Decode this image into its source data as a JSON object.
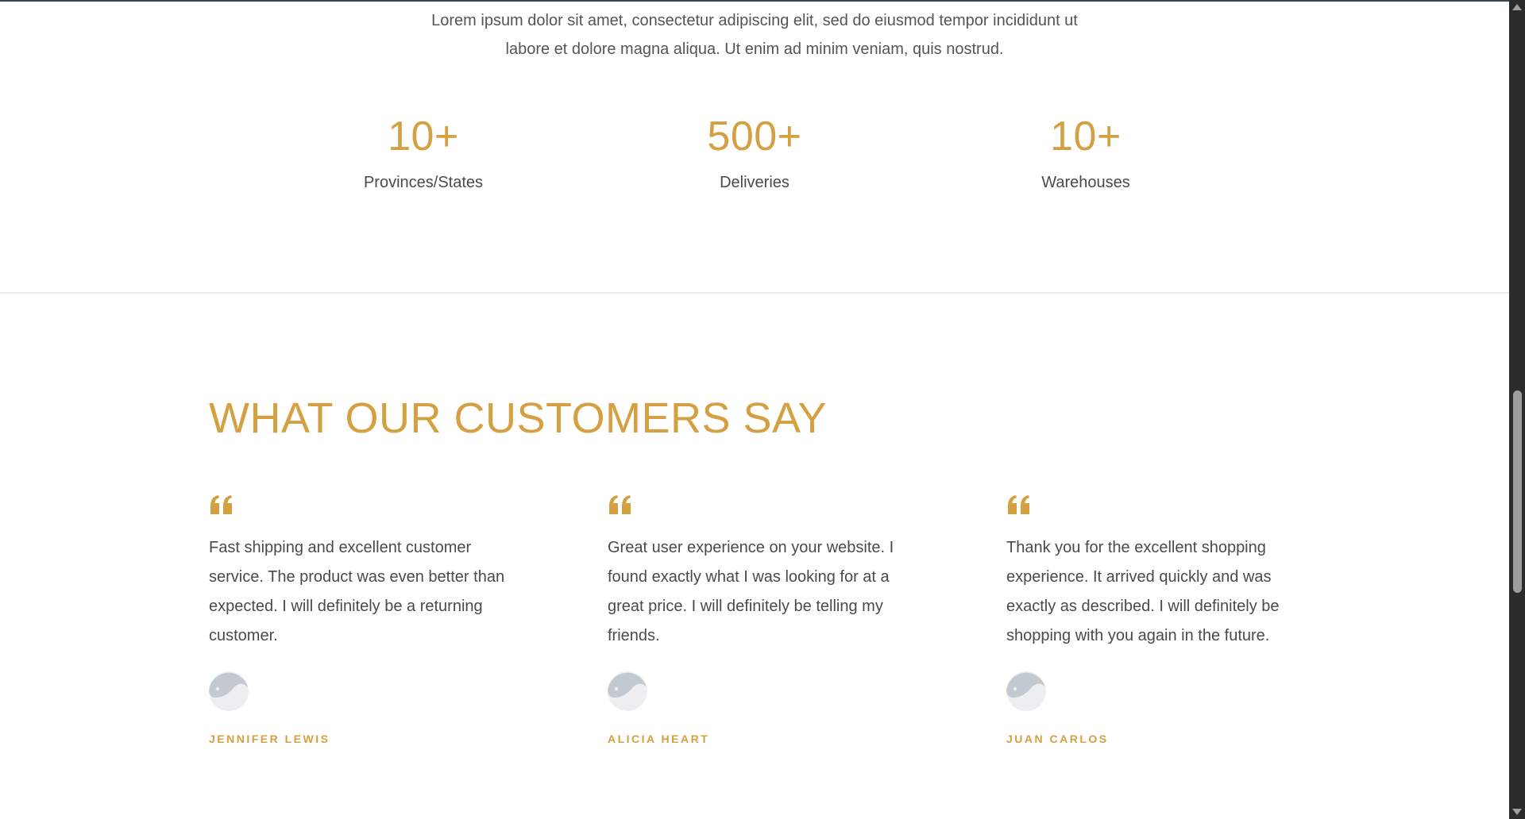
{
  "intro": {
    "line1": "Lorem ipsum dolor sit amet, consectetur adipiscing elit, sed do eiusmod tempor incididunt ut",
    "line2": "labore et dolore magna aliqua. Ut enim ad minim veniam, quis nostrud."
  },
  "stats": [
    {
      "value": "10+",
      "label": "Provinces/States"
    },
    {
      "value": "500+",
      "label": "Deliveries"
    },
    {
      "value": "10+",
      "label": "Warehouses"
    }
  ],
  "testimonials_section": {
    "title": "WHAT OUR CUSTOMERS SAY",
    "items": [
      {
        "quote": "Fast shipping and excellent customer service. The product was even better than expected. I will definitely be a returning customer.",
        "author": "JENNIFER LEWIS",
        "quote_icon": "quote-icon",
        "avatar_icon": "avatar-placeholder-icon"
      },
      {
        "quote": "Great user experience on your website. I found exactly what I was looking for at a great price. I will definitely be telling my friends.",
        "author": "ALICIA HEART",
        "quote_icon": "quote-icon",
        "avatar_icon": "avatar-placeholder-icon"
      },
      {
        "quote": "Thank you for the excellent shopping experience. It arrived quickly and was exactly as described. I will definitely be shopping with you again in the future.",
        "author": "JUAN CARLOS",
        "quote_icon": "quote-icon",
        "avatar_icon": "avatar-placeholder-icon"
      }
    ]
  },
  "colors": {
    "accent": "#d4a042",
    "body_text": "#4a4a4a",
    "divider": "#ececec",
    "scrollbar_track": "#2b2b2b",
    "scrollbar_thumb": "#9e9e9e",
    "avatar_bg": "#eceef0",
    "avatar_fg": "#c3c9d0"
  }
}
